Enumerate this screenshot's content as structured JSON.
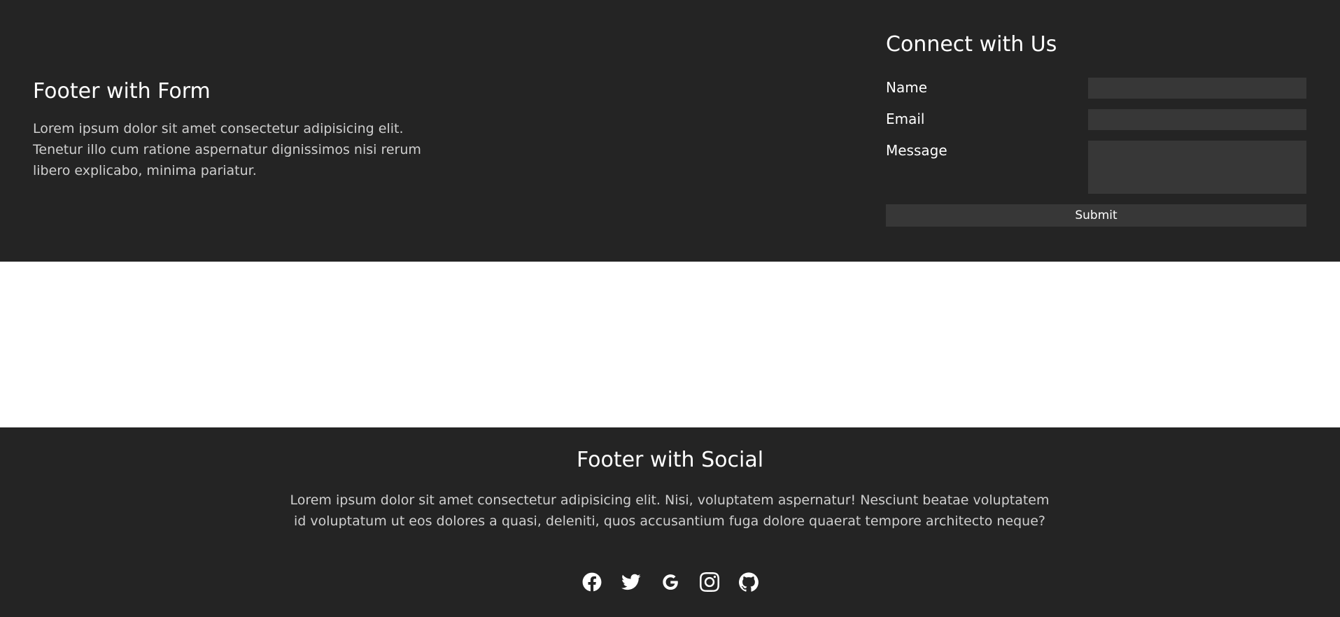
{
  "form_footer": {
    "title": "Footer with Form",
    "text": "Lorem ipsum dolor sit amet consectetur adipisicing elit. Tenetur illo cum ratione aspernatur dignissimos nisi rerum libero explicabo, minima pariatur.",
    "connect_title": "Connect with Us",
    "name_label": "Name",
    "email_label": "Email",
    "message_label": "Message",
    "submit_label": "Submit"
  },
  "social_footer": {
    "title": "Footer with Social",
    "text": "Lorem ipsum dolor sit amet consectetur adipisicing elit. Nisi, voluptatem aspernatur! Nesciunt beatae voluptatem id voluptatum ut eos dolores a quasi, deleniti, quos accusantium fuga dolore quaerat tempore architecto neque?",
    "icons": [
      "facebook-icon",
      "twitter-icon",
      "google-icon",
      "instagram-icon",
      "github-icon"
    ]
  },
  "colors": {
    "footer_bg": "#242424",
    "input_bg": "#373737",
    "body_text": "#cfcfcf",
    "heading": "#ffffff"
  }
}
